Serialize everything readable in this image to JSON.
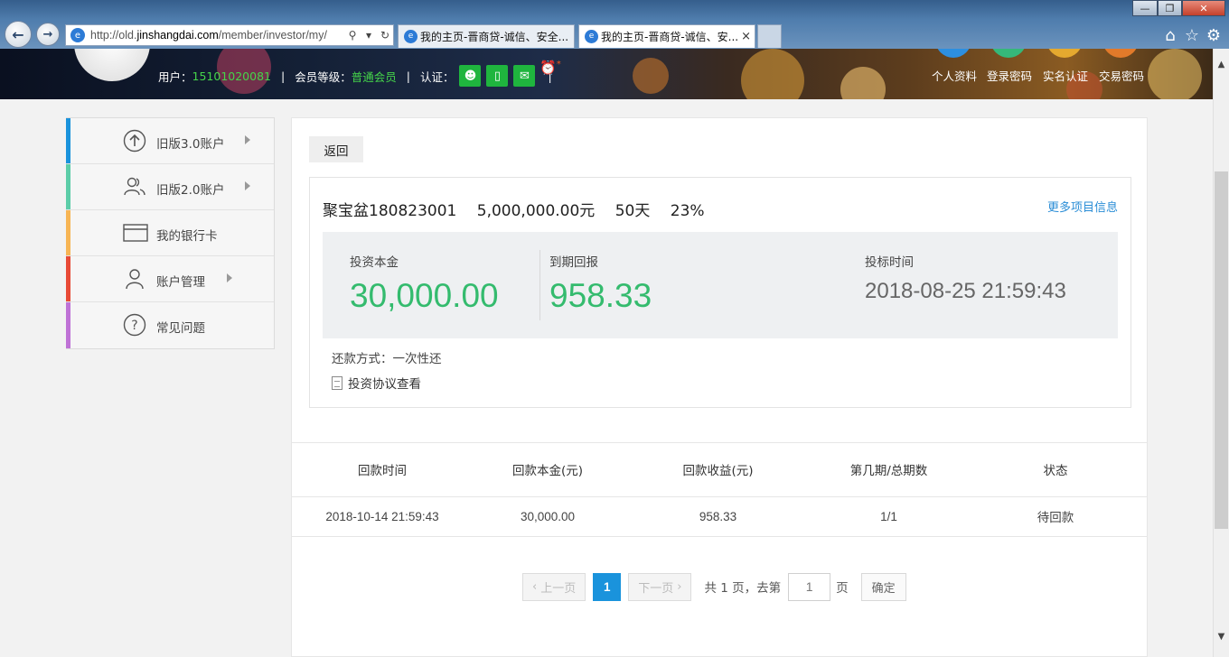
{
  "browser": {
    "url_prefix": "http://old.",
    "url_domain": "jinshangdai.com",
    "url_path": "/member/investor/my/",
    "tabs": [
      {
        "title": "我的主页-晋商贷-诚信、安全..."
      },
      {
        "title": "我的主页-晋商贷-诚信、安...",
        "close": "×"
      }
    ],
    "controls": {
      "minimize": "—",
      "maximize": "❐",
      "close": "✕"
    }
  },
  "header": {
    "user_label": "用户：",
    "user_phone": "15101020081",
    "level_label": "会员等级：",
    "level_value": "普通会员",
    "verify_label": "认证：",
    "alarm_badge": "*",
    "links": [
      "个人资料",
      "登录密码",
      "实名认证",
      "交易密码"
    ]
  },
  "sidebar": {
    "items": [
      {
        "label": "旧版3.0账户",
        "color": "#1a93dc"
      },
      {
        "label": "旧版2.0账户",
        "color": "#5ccda8"
      },
      {
        "label": "我的银行卡",
        "color": "#f7b554"
      },
      {
        "label": "账户管理",
        "color": "#e84a36"
      },
      {
        "label": "常见问题",
        "color": "#bf72d6"
      }
    ]
  },
  "main": {
    "back_label": "返回",
    "project": {
      "name": "聚宝盆180823001",
      "amount": "5,000,000.00元",
      "term": "50天",
      "rate": "23%",
      "more_label": "更多项目信息"
    },
    "stats": {
      "principal_label": "投资本金",
      "principal_value": "30,000.00",
      "return_label": "到期回报",
      "return_value": "958.33",
      "time_label": "投标时间",
      "time_value": "2018-08-25 21:59:43"
    },
    "repay_method": "还款方式：一次性还",
    "agreement_label": "投资协议查看",
    "table": {
      "headers": [
        "回款时间",
        "回款本金(元)",
        "回款收益(元)",
        "第几期/总期数",
        "状态"
      ],
      "rows": [
        [
          "2018-10-14 21:59:43",
          "30,000.00",
          "958.33",
          "1/1",
          "待回款"
        ]
      ]
    },
    "pager": {
      "prev": "上一页",
      "current": "1",
      "next": "下一页",
      "summary": "共 1 页，去第",
      "input_value": "1",
      "page_unit": "页",
      "confirm": "确定"
    }
  },
  "colors": {
    "accent_green": "#34bb6e",
    "link_blue": "#2a8dd6",
    "page_active": "#1a93dc"
  }
}
